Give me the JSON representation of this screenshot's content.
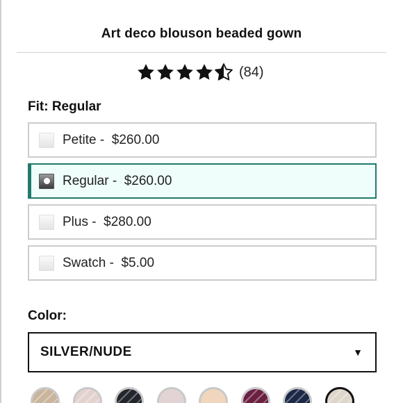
{
  "product": {
    "title": "Art deco blouson beaded gown"
  },
  "rating": {
    "stars": 4.5,
    "max_stars": 5,
    "review_count": "(84)"
  },
  "fit": {
    "label": "Fit: Regular",
    "options": [
      {
        "text": "Petite -  $260.00",
        "selected": false
      },
      {
        "text": "Regular -  $260.00",
        "selected": true
      },
      {
        "text": "Plus -  $280.00",
        "selected": false
      },
      {
        "text": "Swatch -  $5.00",
        "selected": false
      }
    ]
  },
  "color": {
    "label": "Color:",
    "selected_value": "SILVER/NUDE",
    "arrow_icon": "triangle-down-icon",
    "swatches": [
      {
        "color": "#c9b49c",
        "pattern": "stripe",
        "selected": false
      },
      {
        "color": "#e4d2cf",
        "pattern": "stripe",
        "selected": false
      },
      {
        "color": "#22252c",
        "pattern": "stripe",
        "selected": false
      },
      {
        "color": "#e2d4d4",
        "pattern": "plain",
        "selected": false
      },
      {
        "color": "#efd6bd",
        "pattern": "plain",
        "selected": false
      },
      {
        "color": "#6b2042",
        "pattern": "stripe",
        "selected": false
      },
      {
        "color": "#1c2847",
        "pattern": "stripe",
        "selected": false
      },
      {
        "color": "#ddd6cb",
        "pattern": "stripe",
        "selected": true
      }
    ]
  },
  "colors": {
    "selected_border": "#1f7a6a",
    "selected_bg": "#effdfb",
    "option_border": "#cccccc"
  }
}
